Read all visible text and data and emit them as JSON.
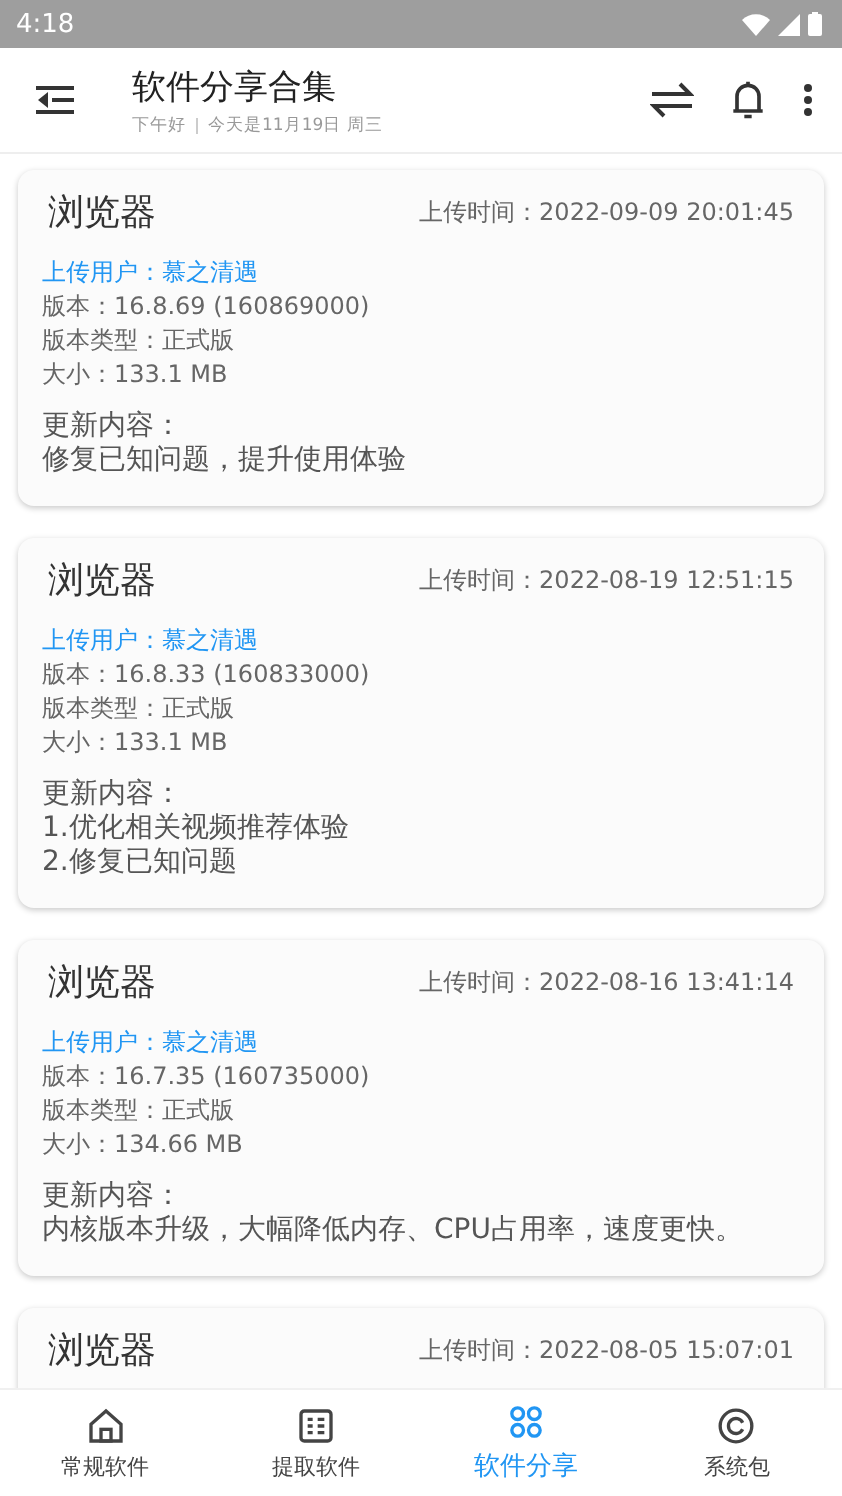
{
  "status_bar": {
    "time": "4:18"
  },
  "header": {
    "title": "软件分享合集",
    "greeting": "下午好",
    "date": "今天是11月19日 周三"
  },
  "posts": [
    {
      "name": "浏览器",
      "upload_time": "上传时间：2022-09-09 20:01:45",
      "uploader": "上传用户：慕之清遇",
      "version": "版本：16.8.69 (160869000)",
      "version_type": "版本类型：正式版",
      "size": "大小：133.1 MB",
      "changes_label": "更新内容：",
      "changes": [
        "修复已知问题，提升使用体验"
      ]
    },
    {
      "name": "浏览器",
      "upload_time": "上传时间：2022-08-19 12:51:15",
      "uploader": "上传用户：慕之清遇",
      "version": "版本：16.8.33 (160833000)",
      "version_type": "版本类型：正式版",
      "size": "大小：133.1 MB",
      "changes_label": "更新内容：",
      "changes": [
        "1.优化相关视频推荐体验",
        "2.修复已知问题"
      ]
    },
    {
      "name": "浏览器",
      "upload_time": "上传时间：2022-08-16 13:41:14",
      "uploader": "上传用户：慕之清遇",
      "version": "版本：16.7.35 (160735000)",
      "version_type": "版本类型：正式版",
      "size": "大小：134.66 MB",
      "changes_label": "更新内容：",
      "changes": [
        "内核版本升级，大幅降低内存、CPU占用率，速度更快。"
      ]
    },
    {
      "name": "浏览器",
      "upload_time": "上传时间：2022-08-05 15:07:01"
    }
  ],
  "nav": [
    {
      "kind": "home",
      "label": "常规软件",
      "selected": false
    },
    {
      "kind": "list",
      "label": "提取软件",
      "selected": false
    },
    {
      "kind": "grid",
      "label": "软件分享",
      "selected": true
    },
    {
      "kind": "system",
      "label": "系统包",
      "selected": false
    }
  ]
}
